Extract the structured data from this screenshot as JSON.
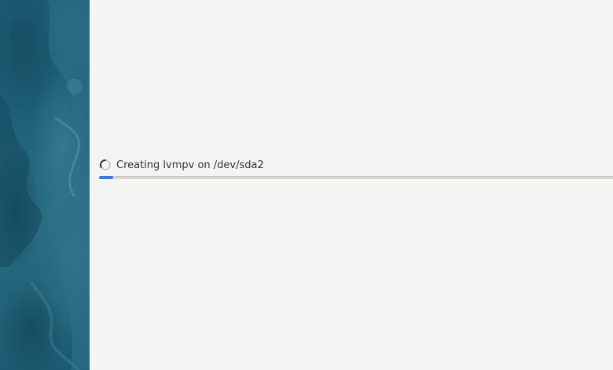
{
  "installer": {
    "status": {
      "text": "Creating lvmpv on /dev/sda2",
      "spinner_icon": "spinner-icon"
    },
    "progress": {
      "fraction": 0.028,
      "fill_color": "#3c7bd0",
      "track_color": "#d8d6d3"
    },
    "sidebar": {
      "background_color": "#1b5a72"
    },
    "content": {
      "background_color": "#f4f4f3"
    }
  }
}
